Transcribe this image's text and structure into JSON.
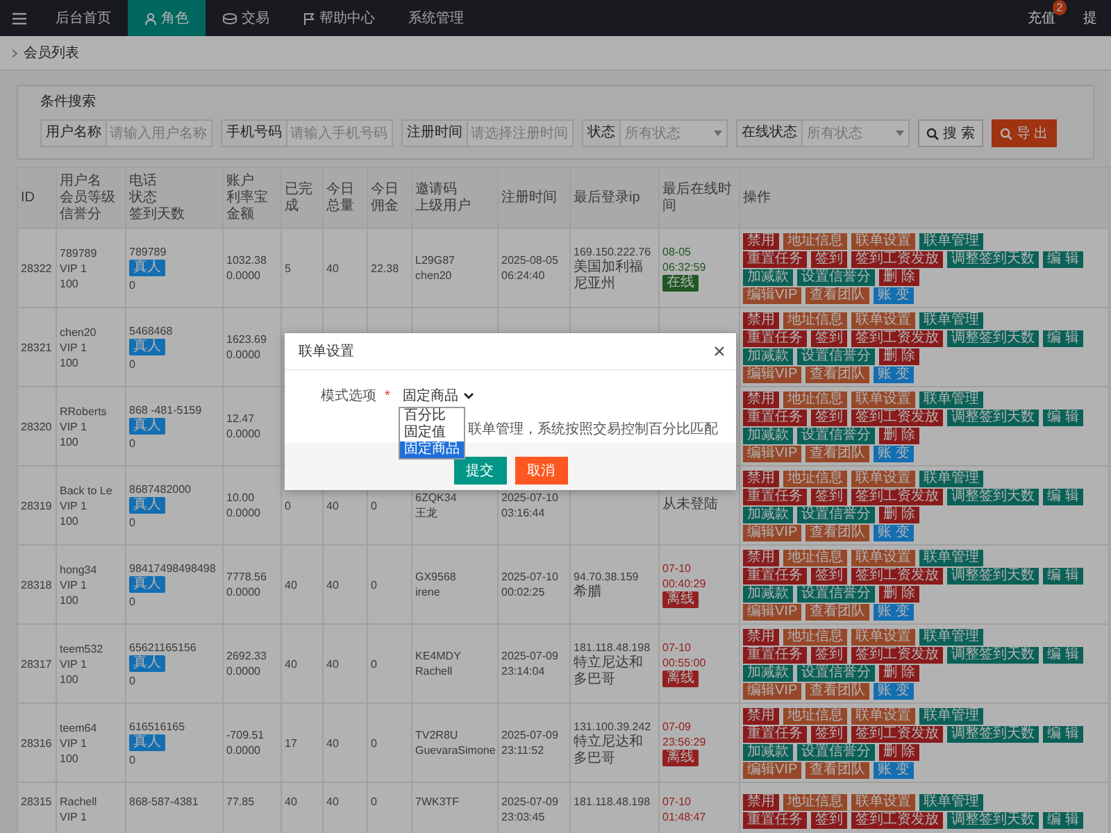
{
  "nav": {
    "items": [
      {
        "label": "后台首页",
        "selected": false
      },
      {
        "label": "角色",
        "selected": true
      },
      {
        "label": "交易",
        "selected": false
      },
      {
        "label": "帮助中心",
        "selected": false
      },
      {
        "label": "系统管理",
        "selected": false
      }
    ],
    "right": [
      {
        "label": "充值",
        "badge": "2"
      },
      {
        "label": "提"
      }
    ]
  },
  "breadcrumb": "会员列表",
  "search": {
    "title": "条件搜索",
    "fields": [
      {
        "label": "用户名称",
        "placeholder": "请输入用户名称",
        "kind": "text"
      },
      {
        "label": "手机号码",
        "placeholder": "请输入手机号码",
        "kind": "text"
      },
      {
        "label": "注册时间",
        "placeholder": "请选择注册时间",
        "kind": "text"
      },
      {
        "label": "状态",
        "placeholder": "所有状态",
        "kind": "select"
      },
      {
        "label": "在线状态",
        "placeholder": "所有状态",
        "kind": "select"
      }
    ],
    "buttons": [
      {
        "label": "搜 索",
        "kind": "default"
      },
      {
        "label": "导 出",
        "kind": "warning"
      }
    ]
  },
  "table": {
    "columns": [
      [
        "ID"
      ],
      [
        "用户名",
        "会员等级",
        "信誉分"
      ],
      [
        "电话",
        "状态",
        "签到天数"
      ],
      [
        "账户",
        "利率宝金额"
      ],
      [
        "已完成"
      ],
      [
        "今日总量"
      ],
      [
        "今日佣金"
      ],
      [
        "邀请码",
        "上级用户"
      ],
      [
        "注册时间"
      ],
      [
        "最后登录ip"
      ],
      [
        "最后在线时间"
      ],
      [
        "操作"
      ]
    ],
    "rows": [
      {
        "id": "28322",
        "username": "789789",
        "level": "VIP 1",
        "credit": "100",
        "phone": "789789",
        "status": "真人",
        "sign_days": "0",
        "balance": "1032.38",
        "rate_amount": "0.0000",
        "done": "5",
        "today_total": "40",
        "today_commission": "22.38",
        "invite_code": "L29G87",
        "parent": "chen20",
        "registered": "2025-08-05 06:24:40",
        "ip": "169.150.222.76",
        "location": "美国加利福尼亚州",
        "last_online": "08-05 06:32:59",
        "online_label": "在线",
        "online": true,
        "actions": [
          [
            {
              "label": "禁用",
              "kind": "danger"
            },
            {
              "label": "地址信息",
              "kind": "warning"
            },
            {
              "label": "联单设置",
              "kind": "warning"
            },
            {
              "label": "联单管理",
              "kind": "teal"
            }
          ],
          [
            {
              "label": "重置任务",
              "kind": "danger"
            },
            {
              "label": "签到",
              "kind": "danger"
            },
            {
              "label": "签到工资发放",
              "kind": "danger"
            },
            {
              "label": "调整签到天数",
              "kind": "teal"
            },
            {
              "label": "编 辑",
              "kind": "teal"
            }
          ],
          [
            {
              "label": "加减款",
              "kind": "teal"
            },
            {
              "label": "设置信誉分",
              "kind": "teal"
            },
            {
              "label": "删 除",
              "kind": "danger"
            }
          ],
          [
            {
              "label": "编辑VIP",
              "kind": "warning"
            },
            {
              "label": "查看团队",
              "kind": "warning"
            },
            {
              "label": "账 变",
              "kind": "blue"
            }
          ]
        ]
      },
      {
        "id": "28321",
        "username": "chen20",
        "level": "VIP 1",
        "credit": "100",
        "phone": "5468468",
        "status": "真人",
        "sign_days": "0",
        "balance": "1623.69",
        "rate_amount": "0.0000",
        "actions": [
          [
            {
              "label": "禁用",
              "kind": "danger"
            },
            {
              "label": "地址信息",
              "kind": "warning"
            },
            {
              "label": "联单设置",
              "kind": "warning"
            },
            {
              "label": "联单管理",
              "kind": "teal"
            }
          ],
          [
            {
              "label": "重置任务",
              "kind": "danger"
            },
            {
              "label": "签到",
              "kind": "danger"
            },
            {
              "label": "签到工资发放",
              "kind": "danger"
            },
            {
              "label": "调整签到天数",
              "kind": "teal"
            },
            {
              "label": "编 辑",
              "kind": "teal"
            }
          ],
          [
            {
              "label": "加减款",
              "kind": "teal"
            },
            {
              "label": "设置信誉分",
              "kind": "teal"
            },
            {
              "label": "删 除",
              "kind": "danger"
            }
          ],
          [
            {
              "label": "编辑VIP",
              "kind": "warning"
            },
            {
              "label": "查看团队",
              "kind": "warning"
            },
            {
              "label": "账 变",
              "kind": "blue"
            }
          ]
        ]
      },
      {
        "id": "28320",
        "username": "RRoberts",
        "level": "VIP 1",
        "credit": "100",
        "phone": "868 -481-5159",
        "status": "真人",
        "sign_days": "0",
        "balance": "12.47",
        "rate_amount": "0.0000",
        "actions": [
          [
            {
              "label": "禁用",
              "kind": "danger"
            },
            {
              "label": "地址信息",
              "kind": "warning"
            },
            {
              "label": "联单设置",
              "kind": "warning"
            },
            {
              "label": "联单管理",
              "kind": "teal"
            }
          ],
          [
            {
              "label": "重置任务",
              "kind": "danger"
            },
            {
              "label": "签到",
              "kind": "danger"
            },
            {
              "label": "签到工资发放",
              "kind": "danger"
            },
            {
              "label": "调整签到天数",
              "kind": "teal"
            },
            {
              "label": "编 辑",
              "kind": "teal"
            }
          ],
          [
            {
              "label": "加减款",
              "kind": "teal"
            },
            {
              "label": "设置信誉分",
              "kind": "teal"
            },
            {
              "label": "删 除",
              "kind": "danger"
            }
          ],
          [
            {
              "label": "编辑VIP",
              "kind": "warning"
            },
            {
              "label": "查看团队",
              "kind": "warning"
            },
            {
              "label": "账 变",
              "kind": "blue"
            }
          ]
        ]
      },
      {
        "id": "28319",
        "username": "Back to Le",
        "level": "VIP 1",
        "credit": "100",
        "phone": "8687482000",
        "status": "真人",
        "sign_days": "0",
        "balance": "10.00",
        "rate_amount": "0.0000",
        "done": "0",
        "today_total": "40",
        "today_commission": "0",
        "invite_code": "6ZQK34",
        "parent": "王龙",
        "registered": "2025-07-10 03:16:44",
        "online_label": "从未登陆",
        "actions": [
          [
            {
              "label": "禁用",
              "kind": "danger"
            },
            {
              "label": "地址信息",
              "kind": "warning"
            },
            {
              "label": "联单设置",
              "kind": "warning"
            },
            {
              "label": "联单管理",
              "kind": "teal"
            }
          ],
          [
            {
              "label": "重置任务",
              "kind": "danger"
            },
            {
              "label": "签到",
              "kind": "danger"
            },
            {
              "label": "签到工资发放",
              "kind": "danger"
            },
            {
              "label": "调整签到天数",
              "kind": "teal"
            },
            {
              "label": "编 辑",
              "kind": "teal"
            }
          ],
          [
            {
              "label": "加减款",
              "kind": "teal"
            },
            {
              "label": "设置信誉分",
              "kind": "teal"
            },
            {
              "label": "删 除",
              "kind": "danger"
            }
          ],
          [
            {
              "label": "编辑VIP",
              "kind": "warning"
            },
            {
              "label": "查看团队",
              "kind": "warning"
            },
            {
              "label": "账 变",
              "kind": "blue"
            }
          ]
        ]
      },
      {
        "id": "28318",
        "username": "hong34",
        "level": "VIP 1",
        "credit": "100",
        "phone": "98417498498498",
        "status": "真人",
        "sign_days": "0",
        "balance": "7778.56",
        "rate_amount": "0.0000",
        "done": "40",
        "today_total": "40",
        "today_commission": "0",
        "invite_code": "GX9568",
        "parent": "irene",
        "registered": "2025-07-10 00:02:25",
        "ip": "94.70.38.159",
        "location": "希腊",
        "last_online": "07-10 00:40:29",
        "online_label": "离线",
        "online": false,
        "actions": [
          [
            {
              "label": "禁用",
              "kind": "danger"
            },
            {
              "label": "地址信息",
              "kind": "warning"
            },
            {
              "label": "联单设置",
              "kind": "warning"
            },
            {
              "label": "联单管理",
              "kind": "teal"
            }
          ],
          [
            {
              "label": "重置任务",
              "kind": "danger"
            },
            {
              "label": "签到",
              "kind": "danger"
            },
            {
              "label": "签到工资发放",
              "kind": "danger"
            },
            {
              "label": "调整签到天数",
              "kind": "teal"
            },
            {
              "label": "编 辑",
              "kind": "teal"
            }
          ],
          [
            {
              "label": "加减款",
              "kind": "teal"
            },
            {
              "label": "设置信誉分",
              "kind": "teal"
            },
            {
              "label": "删 除",
              "kind": "danger"
            }
          ],
          [
            {
              "label": "编辑VIP",
              "kind": "warning"
            },
            {
              "label": "查看团队",
              "kind": "warning"
            },
            {
              "label": "账 变",
              "kind": "blue"
            }
          ]
        ]
      },
      {
        "id": "28317",
        "username": "teem532",
        "level": "VIP 1",
        "credit": "100",
        "phone": "65621165156",
        "status": "真人",
        "sign_days": "0",
        "balance": "2692.33",
        "rate_amount": "0.0000",
        "done": "40",
        "today_total": "40",
        "today_commission": "0",
        "invite_code": "KE4MDY",
        "parent": "Rachell",
        "registered": "2025-07-09 23:14:04",
        "ip": "181.118.48.198",
        "location": "特立尼达和多巴哥",
        "last_online": "07-10 00:55:00",
        "online_label": "离线",
        "online": false,
        "actions": [
          [
            {
              "label": "禁用",
              "kind": "danger"
            },
            {
              "label": "地址信息",
              "kind": "warning"
            },
            {
              "label": "联单设置",
              "kind": "warning"
            },
            {
              "label": "联单管理",
              "kind": "teal"
            }
          ],
          [
            {
              "label": "重置任务",
              "kind": "danger"
            },
            {
              "label": "签到",
              "kind": "danger"
            },
            {
              "label": "签到工资发放",
              "kind": "danger"
            },
            {
              "label": "调整签到天数",
              "kind": "teal"
            },
            {
              "label": "编 辑",
              "kind": "teal"
            }
          ],
          [
            {
              "label": "加减款",
              "kind": "teal"
            },
            {
              "label": "设置信誉分",
              "kind": "teal"
            },
            {
              "label": "删 除",
              "kind": "danger"
            }
          ],
          [
            {
              "label": "编辑VIP",
              "kind": "warning"
            },
            {
              "label": "查看团队",
              "kind": "warning"
            },
            {
              "label": "账 变",
              "kind": "blue"
            }
          ]
        ]
      },
      {
        "id": "28316",
        "username": "teem64",
        "level": "VIP 1",
        "credit": "100",
        "phone": "616516165",
        "status": "真人",
        "sign_days": "0",
        "balance": "-709.51",
        "rate_amount": "0.0000",
        "done": "17",
        "today_total": "40",
        "today_commission": "0",
        "invite_code": "TV2R8U",
        "parent": "GuevaraSimone",
        "registered": "2025-07-09 23:11:52",
        "ip": "131.100.39.242",
        "location": "特立尼达和多巴哥",
        "last_online": "07-09 23:56:29",
        "online_label": "离线",
        "online": false,
        "actions": [
          [
            {
              "label": "禁用",
              "kind": "danger"
            },
            {
              "label": "地址信息",
              "kind": "warning"
            },
            {
              "label": "联单设置",
              "kind": "warning"
            },
            {
              "label": "联单管理",
              "kind": "teal"
            }
          ],
          [
            {
              "label": "重置任务",
              "kind": "danger"
            },
            {
              "label": "签到",
              "kind": "danger"
            },
            {
              "label": "签到工资发放",
              "kind": "danger"
            },
            {
              "label": "调整签到天数",
              "kind": "teal"
            },
            {
              "label": "编 辑",
              "kind": "teal"
            }
          ],
          [
            {
              "label": "加减款",
              "kind": "teal"
            },
            {
              "label": "设置信誉分",
              "kind": "teal"
            },
            {
              "label": "删 除",
              "kind": "danger"
            }
          ],
          [
            {
              "label": "编辑VIP",
              "kind": "warning"
            },
            {
              "label": "查看团队",
              "kind": "warning"
            },
            {
              "label": "账 变",
              "kind": "blue"
            }
          ]
        ]
      },
      {
        "id": "28315",
        "username": "Rachell",
        "level": "VIP 1",
        "phone": "868-587-4381",
        "balance": "77.85",
        "done": "40",
        "today_total": "40",
        "today_commission": "0",
        "invite_code": "7WK3TF",
        "registered": "2025-07-09 23:03:45",
        "ip": "181.118.48.198",
        "last_online": "07-10 01:48:47",
        "online": false,
        "actions": [
          [
            {
              "label": "禁用",
              "kind": "danger"
            },
            {
              "label": "地址信息",
              "kind": "warning"
            },
            {
              "label": "联单设置",
              "kind": "warning"
            },
            {
              "label": "联单管理",
              "kind": "teal"
            }
          ],
          [
            {
              "label": "重置任务",
              "kind": "danger"
            },
            {
              "label": "签到",
              "kind": "danger"
            },
            {
              "label": "签到工资发放",
              "kind": "danger"
            },
            {
              "label": "调整签到天数",
              "kind": "teal"
            },
            {
              "label": "编 辑",
              "kind": "teal"
            }
          ]
        ]
      }
    ]
  },
  "modal": {
    "title": "联单设置",
    "field": {
      "label": "模式选项",
      "required_mark": "*",
      "value": "固定商品",
      "options": [
        {
          "label": "百分比",
          "selected": false
        },
        {
          "label": "固定值",
          "selected": false
        },
        {
          "label": "固定商品",
          "selected": true
        }
      ]
    },
    "hint": "联单管理，系统按照交易控制百分比匹配",
    "buttons": [
      {
        "label": "提交",
        "kind": "primary"
      },
      {
        "label": "取消",
        "kind": "warning"
      }
    ]
  }
}
